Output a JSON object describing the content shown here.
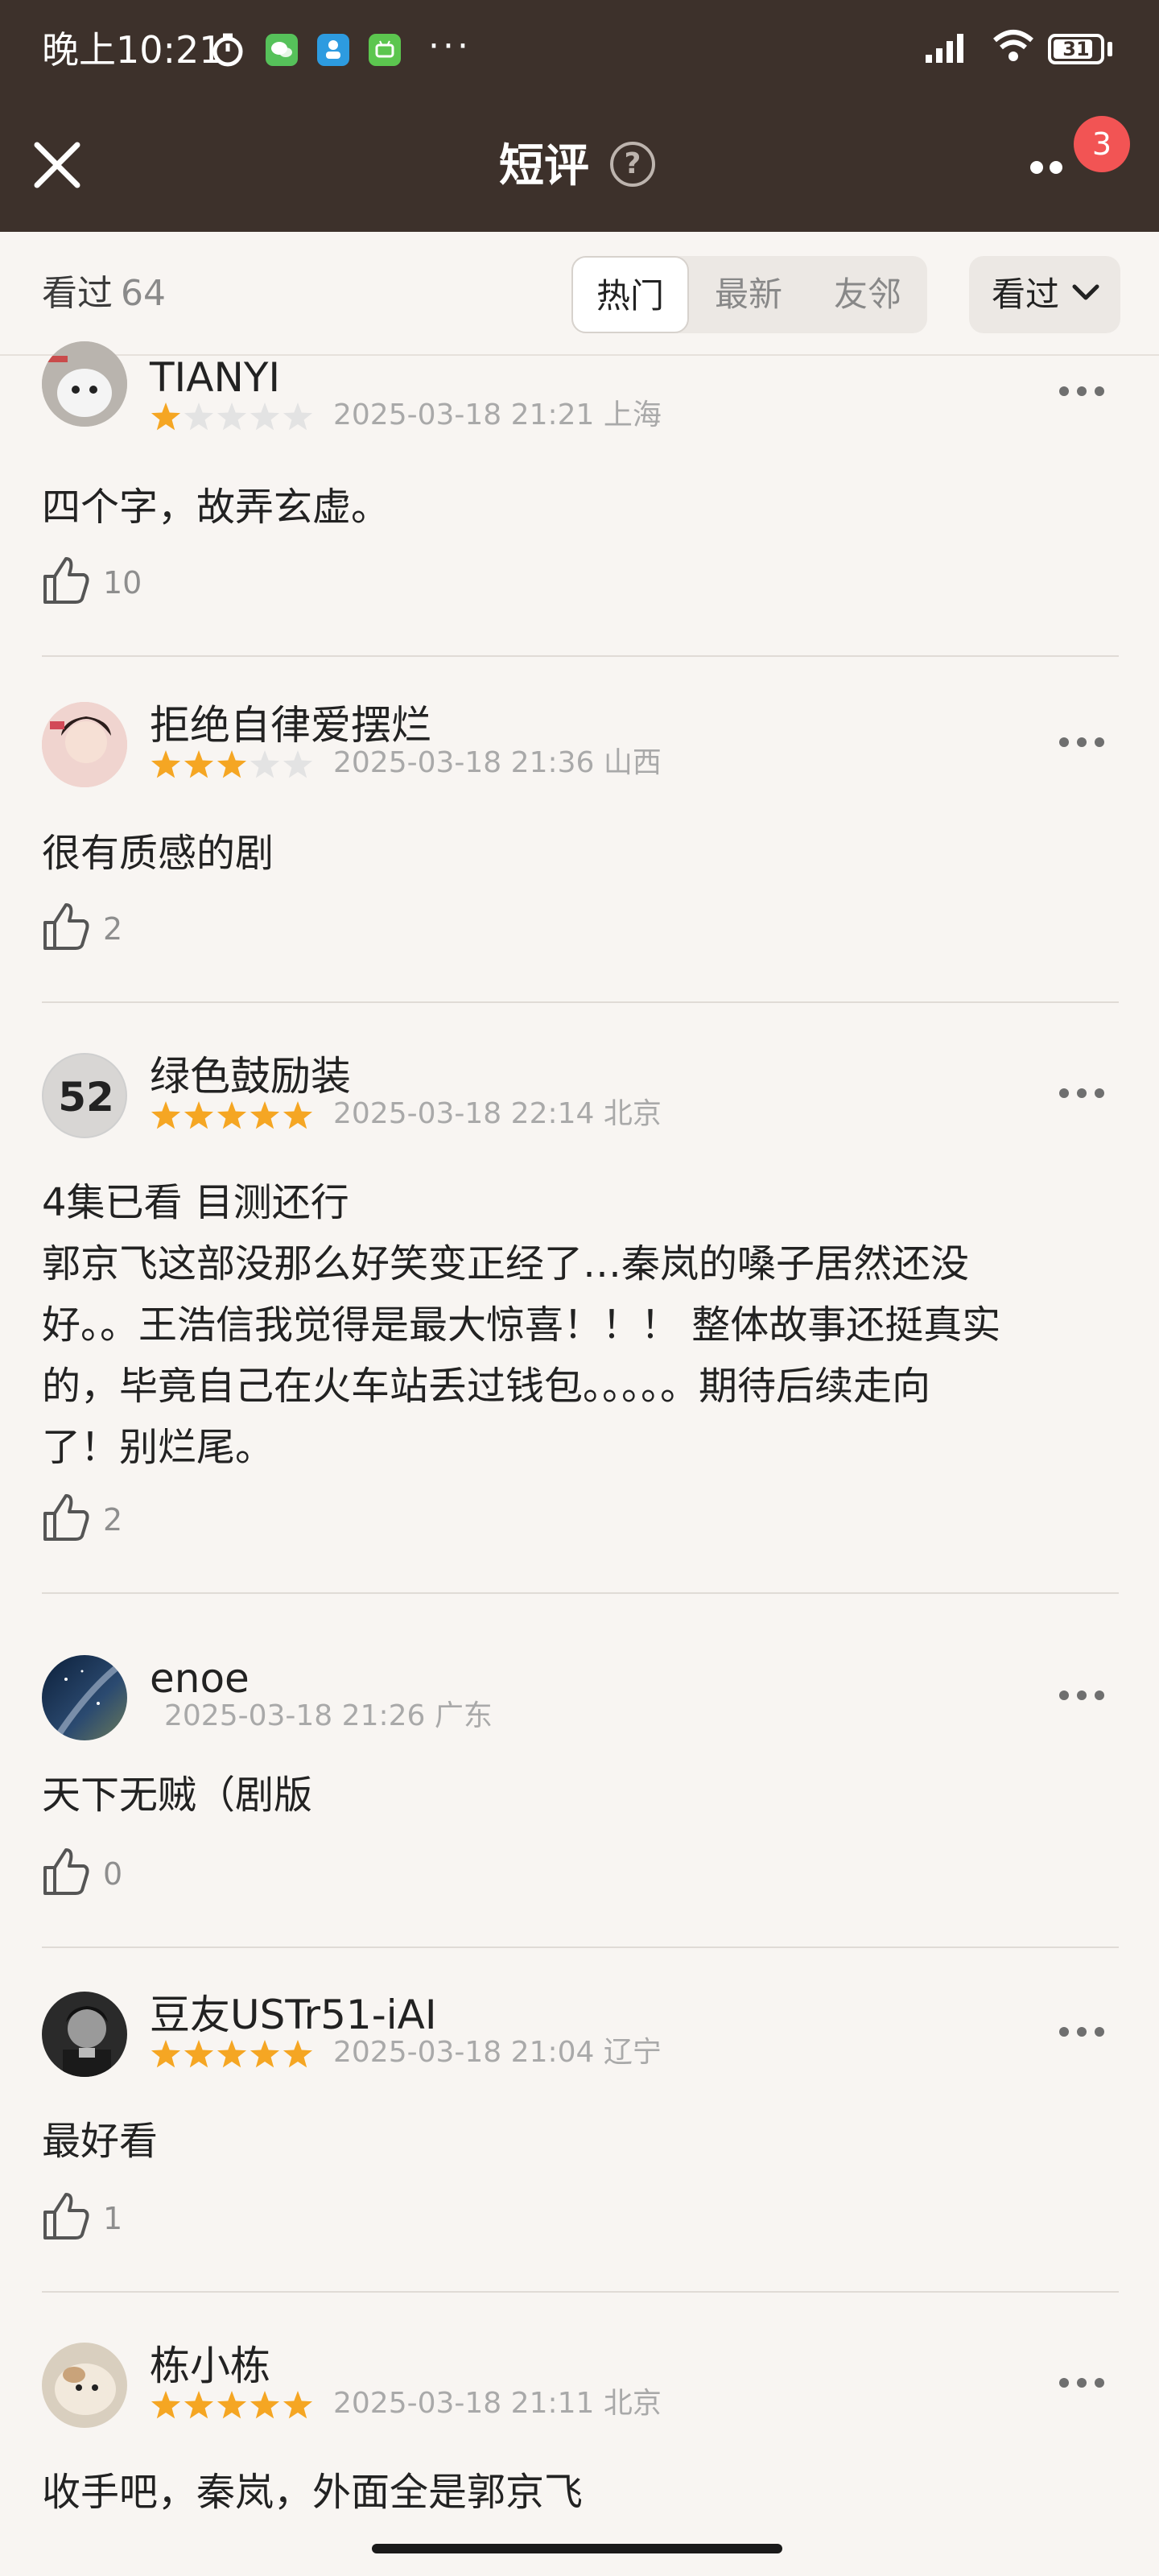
{
  "status": {
    "time": "晚上10:21",
    "more": "···",
    "battery": "31"
  },
  "nav": {
    "title": "短评",
    "help": "?",
    "badge": "3"
  },
  "filter": {
    "seen_label": "看过",
    "seen_count": "64",
    "tabs": [
      "热门",
      "最新",
      "友邻"
    ],
    "active_tab": "热门",
    "dropdown_label": "看过"
  },
  "colors": {
    "header_bg": "#3d312b",
    "page_bg": "#f8f5f2",
    "star_filled": "#f5a623",
    "star_empty": "#e3e3e3",
    "badge": "#f25454"
  },
  "comments": [
    {
      "username": "TIANYI",
      "rating": 1,
      "date": "2025-03-18 21:21",
      "location": "上海",
      "text": "四个字，故弄玄虚。",
      "likes": "10",
      "avatar_icon": "white-cat-avatar"
    },
    {
      "username": "拒绝自律爱摆烂",
      "rating": 3,
      "date": "2025-03-18 21:36",
      "location": "山西",
      "text": "很有质感的剧",
      "likes": "2",
      "avatar_icon": "woman-portrait-avatar"
    },
    {
      "username": "绿色鼓励装",
      "rating": 5,
      "date": "2025-03-18 22:14",
      "location": "北京",
      "text_lines": [
        "4集已看 目测还行",
        "郭京飞这部没那么好笑变正经了…秦岚的嗓子居然还没",
        "好。。王浩信我觉得是最大惊喜！！！ 整体故事还挺真实",
        "的，毕竟自己在火车站丢过钱包。。。。。期待后续走向",
        "了！别烂尾。"
      ],
      "likes": "2",
      "avatar_text": "52"
    },
    {
      "username": "enoe",
      "rating": 0,
      "date": "2025-03-18 21:26",
      "location": "广东",
      "text": "天下无贼（剧版",
      "likes": "0",
      "avatar_icon": "night-sky-avatar"
    },
    {
      "username": "豆友USTr51-iAI",
      "rating": 5,
      "date": "2025-03-18 21:04",
      "location": "辽宁",
      "text": "最好看",
      "likes": "1",
      "avatar_icon": "bw-portrait-avatar"
    },
    {
      "username": "栋小栋",
      "rating": 5,
      "date": "2025-03-18 21:11",
      "location": "北京",
      "text": "收手吧，秦岚，外面全是郭京飞",
      "avatar_icon": "guinea-pig-avatar"
    }
  ]
}
